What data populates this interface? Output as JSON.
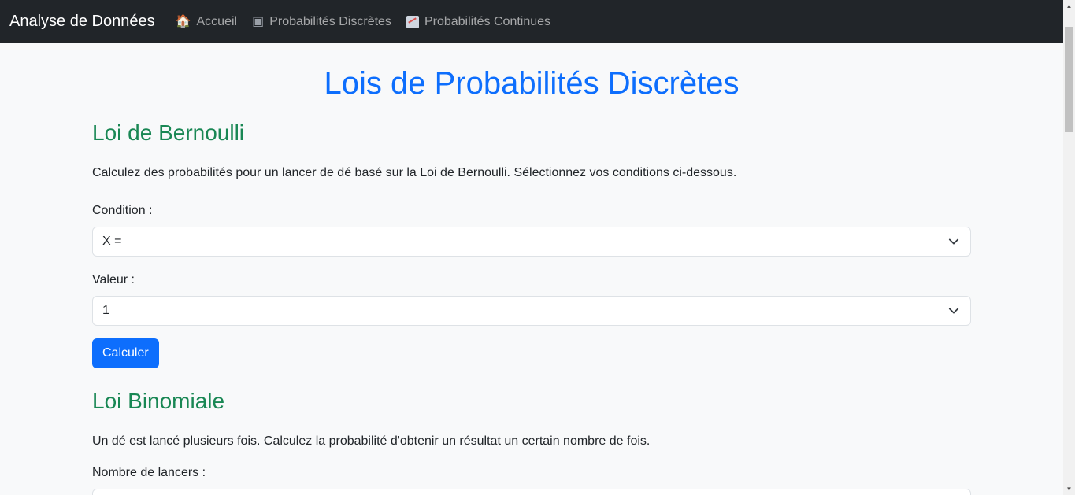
{
  "navbar": {
    "brand": "Analyse de Données",
    "links": [
      {
        "icon": "house-icon",
        "label": "Accueil"
      },
      {
        "icon": "die-icon",
        "label": "Probabilités Discrètes"
      },
      {
        "icon": "chart-icon",
        "label": "Probabilités Continues"
      }
    ]
  },
  "main": {
    "title": "Lois de Probabilités Discrètes",
    "bernoulli": {
      "title": "Loi de Bernoulli",
      "description": "Calculez des probabilités pour un lancer de dé basé sur la Loi de Bernoulli. Sélectionnez vos conditions ci-dessous.",
      "condition_label": "Condition :",
      "condition_value": "X =",
      "value_label": "Valeur :",
      "value_value": "1",
      "button_label": "Calculer"
    },
    "binomial": {
      "title": "Loi Binomiale",
      "description": "Un dé est lancé plusieurs fois. Calculez la probabilité d'obtenir un résultat un certain nombre de fois.",
      "throws_label": "Nombre de lancers :"
    }
  },
  "colors": {
    "navbar_bg": "#212529",
    "title_blue": "#0d6efd",
    "section_green": "#198754",
    "button_blue": "#0d6efd"
  }
}
